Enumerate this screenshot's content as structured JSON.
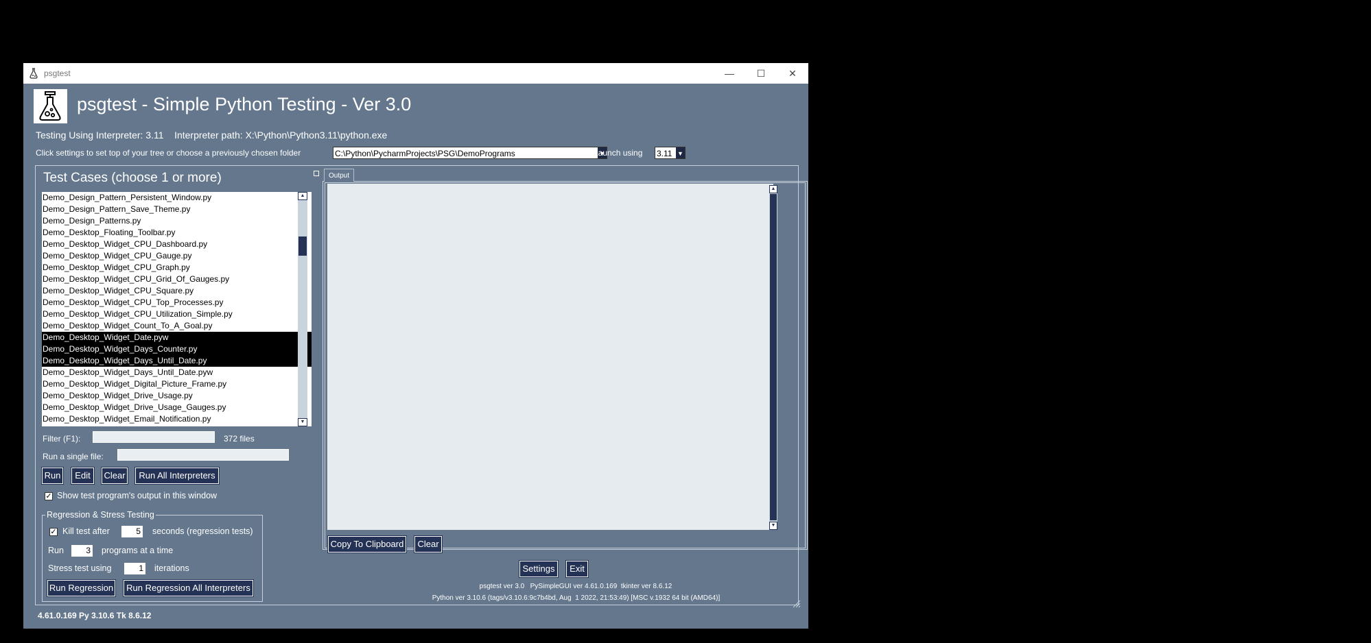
{
  "window": {
    "title": "psgtest",
    "app_icon": "flask-icon",
    "minimize_icon": "minimize-icon",
    "maximize_icon": "maximize-icon",
    "close_icon": "close-icon"
  },
  "header": {
    "title": "psgtest - Simple Python Testing - Ver 3.0",
    "interpreter_text": "Testing Using Interpreter: 3.11    Interpreter path: X:\\Python\\Python3.11\\python.exe",
    "folder_prompt": "Click settings to set top of your tree or choose a previously chosen folder",
    "folder_value": "C:\\Python\\PycharmProjects\\PSG\\DemoPrograms",
    "launch_label": "Launch using",
    "launch_value": "3.11"
  },
  "test_cases": {
    "title": "Test Cases (choose 1 or more)",
    "files": [
      {
        "name": "Demo_Design_Pattern_Persistent_Window.py",
        "selected": false
      },
      {
        "name": "Demo_Design_Pattern_Save_Theme.py",
        "selected": false
      },
      {
        "name": "Demo_Design_Patterns.py",
        "selected": false
      },
      {
        "name": "Demo_Desktop_Floating_Toolbar.py",
        "selected": false
      },
      {
        "name": "Demo_Desktop_Widget_CPU_Dashboard.py",
        "selected": false
      },
      {
        "name": "Demo_Desktop_Widget_CPU_Gauge.py",
        "selected": false
      },
      {
        "name": "Demo_Desktop_Widget_CPU_Graph.py",
        "selected": false
      },
      {
        "name": "Demo_Desktop_Widget_CPU_Grid_Of_Gauges.py",
        "selected": false
      },
      {
        "name": "Demo_Desktop_Widget_CPU_Square.py",
        "selected": false
      },
      {
        "name": "Demo_Desktop_Widget_CPU_Top_Processes.py",
        "selected": false
      },
      {
        "name": "Demo_Desktop_Widget_CPU_Utilization_Simple.py",
        "selected": false
      },
      {
        "name": "Demo_Desktop_Widget_Count_To_A_Goal.py",
        "selected": false
      },
      {
        "name": "Demo_Desktop_Widget_Date.pyw",
        "selected": true
      },
      {
        "name": "Demo_Desktop_Widget_Days_Counter.py",
        "selected": true
      },
      {
        "name": "Demo_Desktop_Widget_Days_Until_Date.py",
        "selected": true
      },
      {
        "name": "Demo_Desktop_Widget_Days_Until_Date.pyw",
        "selected": false
      },
      {
        "name": "Demo_Desktop_Widget_Digital_Picture_Frame.py",
        "selected": false
      },
      {
        "name": "Demo_Desktop_Widget_Drive_Usage.py",
        "selected": false
      },
      {
        "name": "Demo_Desktop_Widget_Drive_Usage_Gauges.py",
        "selected": false
      },
      {
        "name": "Demo_Desktop_Widget_Email_Notification.py",
        "selected": false
      }
    ],
    "filter_label": "Filter (F1):",
    "filter_value": "",
    "file_count": "372 files",
    "single_file_label": "Run a single file:",
    "single_file_value": "",
    "run_label": "Run",
    "edit_label": "Edit",
    "clear_label": "Clear",
    "run_all_label": "Run All Interpreters",
    "show_output_label": "Show test program's output in this window",
    "show_output_checked": true
  },
  "regression": {
    "title": "Regression & Stress Testing",
    "kill_label": "Kill test after",
    "kill_checked": true,
    "kill_value": "5",
    "kill_suffix": "seconds (regression tests)",
    "run_label": "Run",
    "run_value": "3",
    "run_suffix": "programs at a time",
    "stress_label": "Stress test using",
    "stress_value": "1",
    "stress_suffix": "iterations",
    "run_regression_label": "Run Regression",
    "run_regression_all_label": "Run Regression All Interpreters"
  },
  "output": {
    "tab_label": "Output",
    "content": "",
    "copy_label": "Copy To Clipboard",
    "clear_label": "Clear"
  },
  "footer": {
    "settings_label": "Settings",
    "exit_label": "Exit",
    "version_line1": "psgtest ver 3.0   PySimpleGUI ver 4.61.0.169  tkinter ver 8.6.12",
    "version_line2": "Python ver 3.10.6 (tags/v3.10.6:9c7b4bd, Aug  1 2022, 21:53:49) [MSC v.1932 64 bit (AMD64)]",
    "status": "4.61.0.169 Py 3.10.6 Tk 8.6.12"
  }
}
